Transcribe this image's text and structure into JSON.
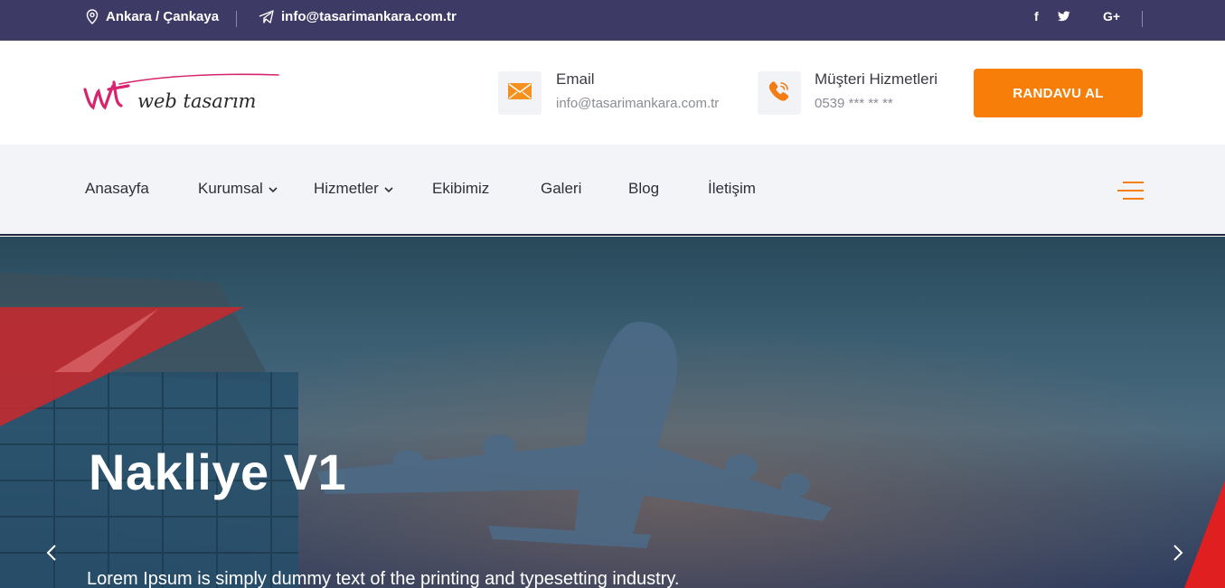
{
  "topbar": {
    "location": "Ankara / Çankaya",
    "email": "info@tasarimankara.com.tr",
    "social": [
      "facebook-icon",
      "twitter-icon",
      "google-plus-icon"
    ],
    "google_plus_label": "G+",
    "facebook_label": "f"
  },
  "header": {
    "logo_text": "web tasarım",
    "logo_mark": "wt",
    "email_title": "Email",
    "email_value": "info@tasarimankara.com.tr",
    "phone_title": "Müşteri Hizmetleri",
    "phone_value": "0539 *** ** **",
    "cta_label": "RANDAVU AL"
  },
  "nav": {
    "items": [
      {
        "label": "Anasayfa",
        "dropdown": false
      },
      {
        "label": "Kurumsal",
        "dropdown": true
      },
      {
        "label": "Hizmetler",
        "dropdown": true
      },
      {
        "label": "Ekibimiz",
        "dropdown": false
      },
      {
        "label": "Galeri",
        "dropdown": false
      },
      {
        "label": "Blog",
        "dropdown": false
      },
      {
        "label": "İletişim",
        "dropdown": false
      }
    ]
  },
  "hero": {
    "title": "Nakliye V1",
    "text": "Lorem Ipsum is simply dummy text of the printing and typesetting industry."
  },
  "colors": {
    "topbar_bg": "#3e3a66",
    "accent": "#f77f09",
    "logo_pink": "#d6246e",
    "nav_bg": "#f3f4f7"
  }
}
